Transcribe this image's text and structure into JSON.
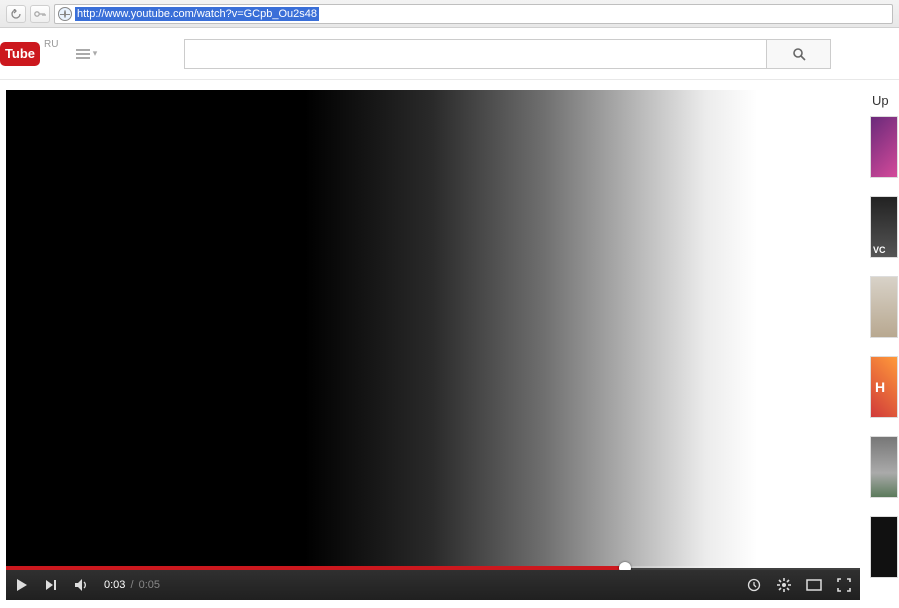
{
  "browser": {
    "url": "http://www.youtube.com/watch?v=GCpb_Ou2s48"
  },
  "masthead": {
    "logo_text": "Tube",
    "region": "RU",
    "search_value": "",
    "search_placeholder": ""
  },
  "player": {
    "time_current": "0:03",
    "time_separator": "/",
    "time_duration": "0:05",
    "progress_percent": 72.5
  },
  "sidebar": {
    "upnext_label": "Up",
    "thumbs": [
      {
        "overlay": ""
      },
      {
        "overlay": "VC"
      },
      {
        "overlay": ""
      },
      {
        "overlay": "H"
      },
      {
        "overlay": ""
      },
      {
        "overlay": ""
      }
    ]
  }
}
